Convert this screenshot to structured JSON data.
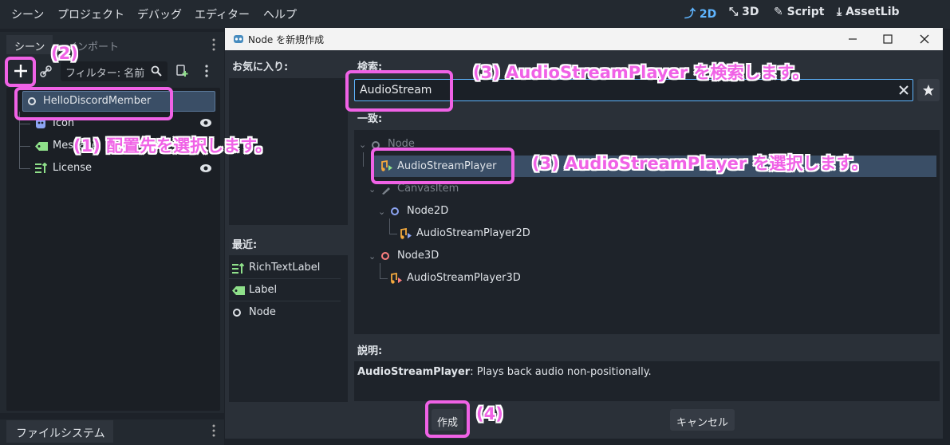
{
  "menu": {
    "items": [
      "シーン",
      "プロジェクト",
      "デバッグ",
      "エディター",
      "ヘルプ"
    ],
    "modes": [
      {
        "label": "2D",
        "icon": "2d-mode-icon",
        "active": true
      },
      {
        "label": "3D",
        "icon": "3d-mode-icon",
        "active": false
      },
      {
        "label": "Script",
        "icon": "script-icon",
        "active": false
      },
      {
        "label": "AssetLib",
        "icon": "assetlib-icon",
        "active": false
      }
    ]
  },
  "scene_dock": {
    "tabs": [
      "シーン",
      "インポート"
    ],
    "filter_placeholder": "フィルター: 名前",
    "tree": [
      {
        "label": "HelloDiscordMember",
        "icon": "node-circle-icon",
        "selected": true
      },
      {
        "label": "Icon",
        "icon": "sprite-icon",
        "visible": true
      },
      {
        "label": "Message",
        "icon": "label-icon",
        "visible": true
      },
      {
        "label": "License",
        "icon": "richtextlabel-icon",
        "visible": true
      }
    ]
  },
  "filesystem_dock": {
    "tab": "ファイルシステム"
  },
  "dialog": {
    "title": "Node を新規作成",
    "favorites_label": "お気に入り:",
    "recent_label": "最近:",
    "recent": [
      {
        "label": "RichTextLabel",
        "icon": "richtextlabel-icon"
      },
      {
        "label": "Label",
        "icon": "label-icon"
      },
      {
        "label": "Node",
        "icon": "node-circle-icon"
      }
    ],
    "search_label": "検索:",
    "search_value": "AudioStream",
    "matches_label": "一致:",
    "tree": [
      {
        "label": "Node",
        "icon": "node-circle-icon",
        "dim": true
      },
      {
        "label": "AudioStreamPlayer",
        "icon": "audio-icon",
        "selected": true
      },
      {
        "label": "CanvasItem",
        "icon": "canvasitem-icon",
        "dim": true
      },
      {
        "label": "Node2D",
        "icon": "node2d-icon"
      },
      {
        "label": "AudioStreamPlayer2D",
        "icon": "audio-icon"
      },
      {
        "label": "Node3D",
        "icon": "node3d-icon"
      },
      {
        "label": "AudioStreamPlayer3D",
        "icon": "audio-icon"
      }
    ],
    "description_label": "説明:",
    "description_name": "AudioStreamPlayer",
    "description_text": ": Plays back audio non-positionally.",
    "create_button": "作成",
    "cancel_button": "キャンセル"
  },
  "annotations": {
    "step1": "(1) 配置先を選択します。",
    "step2": "(2)",
    "step3_search": "(3) AudioStreamPlayer を検索します。",
    "step3_select": "(3) AudioStreamPlayer を選択します。",
    "step4": "(4)"
  },
  "colors": {
    "accent": "#5fb5ff",
    "annotation": "#f062e6",
    "selection": "#3a4e66",
    "audio_icon": "#f4a93d"
  }
}
